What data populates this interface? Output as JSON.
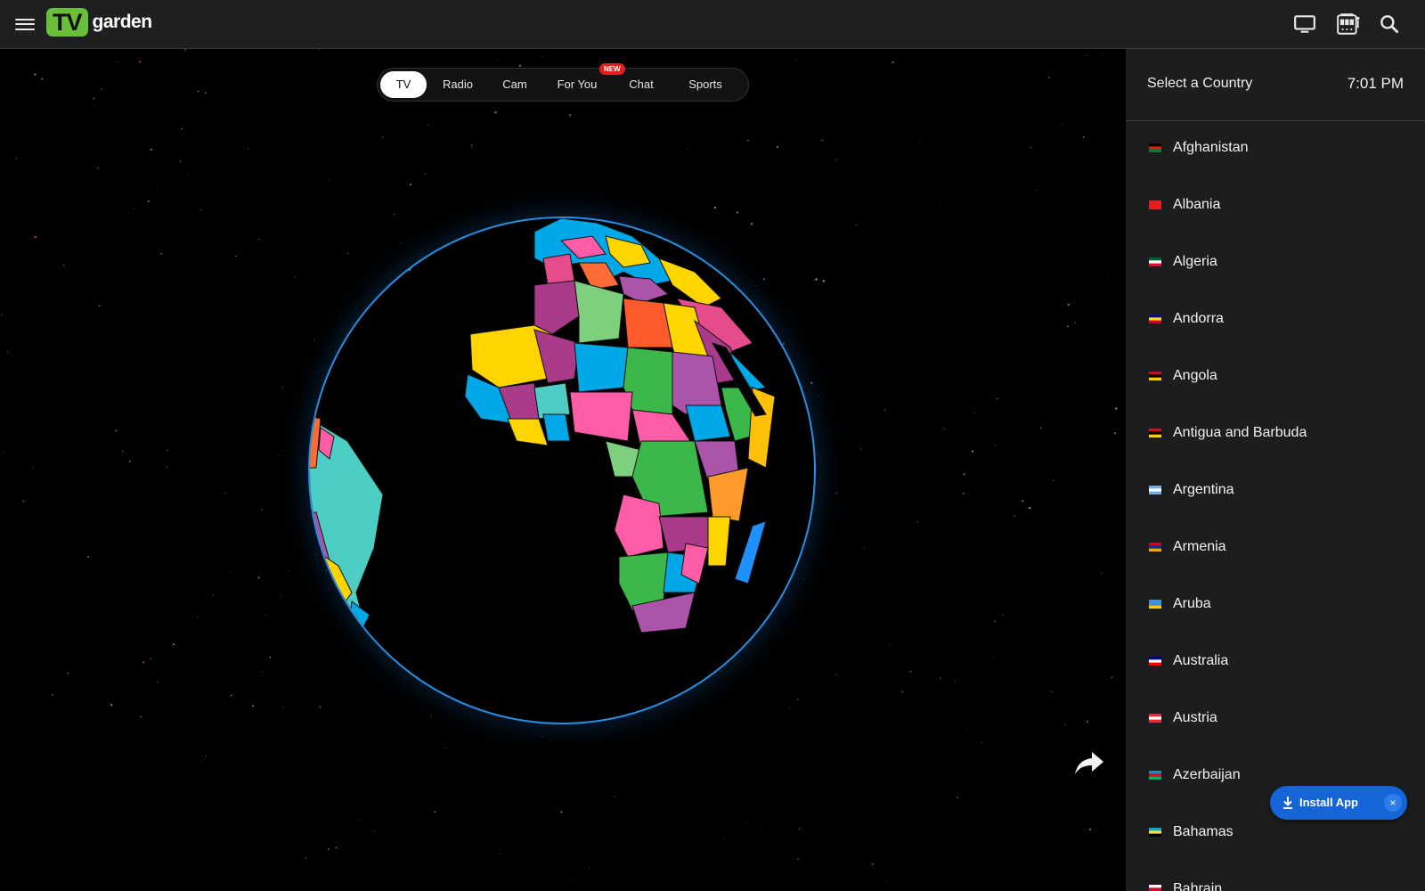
{
  "header": {
    "logo_badge": "TV",
    "logo_text": "garden",
    "icons": [
      "menu-icon",
      "tv-icon",
      "slot-machine-icon",
      "search-icon"
    ]
  },
  "tabs": {
    "items": [
      {
        "label": "TV",
        "active": true
      },
      {
        "label": "Radio",
        "active": false
      },
      {
        "label": "Cam",
        "active": false
      },
      {
        "label": "For You",
        "active": false
      },
      {
        "label": "Chat",
        "active": false
      },
      {
        "label": "Sports",
        "active": false
      }
    ],
    "new_badge": "NEW"
  },
  "sidebar": {
    "title": "Select a Country",
    "time": "7:01 PM",
    "countries": [
      {
        "name": "Afghanistan",
        "flag": [
          "#000000",
          "#d32011",
          "#007a36"
        ]
      },
      {
        "name": "Albania",
        "flag": [
          "#e41e20",
          "#e41e20",
          "#e41e20"
        ]
      },
      {
        "name": "Algeria",
        "flag": [
          "#006233",
          "#ffffff",
          "#d21034"
        ]
      },
      {
        "name": "Andorra",
        "flag": [
          "#10069f",
          "#fedd00",
          "#d50032"
        ]
      },
      {
        "name": "Angola",
        "flag": [
          "#cc092f",
          "#000000",
          "#ffcb00"
        ]
      },
      {
        "name": "Antigua and Barbuda",
        "flag": [
          "#ce1126",
          "#000000",
          "#fcd116"
        ]
      },
      {
        "name": "Argentina",
        "flag": [
          "#74acdf",
          "#ffffff",
          "#74acdf"
        ]
      },
      {
        "name": "Armenia",
        "flag": [
          "#d90012",
          "#0033a0",
          "#f2a800"
        ]
      },
      {
        "name": "Aruba",
        "flag": [
          "#418fde",
          "#418fde",
          "#ffd100"
        ]
      },
      {
        "name": "Australia",
        "flag": [
          "#00008b",
          "#ffffff",
          "#ff0000"
        ]
      },
      {
        "name": "Austria",
        "flag": [
          "#ed2939",
          "#ffffff",
          "#ed2939"
        ]
      },
      {
        "name": "Azerbaijan",
        "flag": [
          "#0092bc",
          "#e4002b",
          "#00af66"
        ]
      },
      {
        "name": "Bahamas",
        "flag": [
          "#00abc9",
          "#fae042",
          "#000000"
        ]
      },
      {
        "name": "Bahrain",
        "flag": [
          "#ffffff",
          "#ce1126",
          "#ce1126"
        ]
      }
    ]
  },
  "install": {
    "label": "Install App",
    "close": "×"
  },
  "colors": {
    "accent": "#6abf3a",
    "install": "#1565d8",
    "badge": "#e0201f"
  }
}
